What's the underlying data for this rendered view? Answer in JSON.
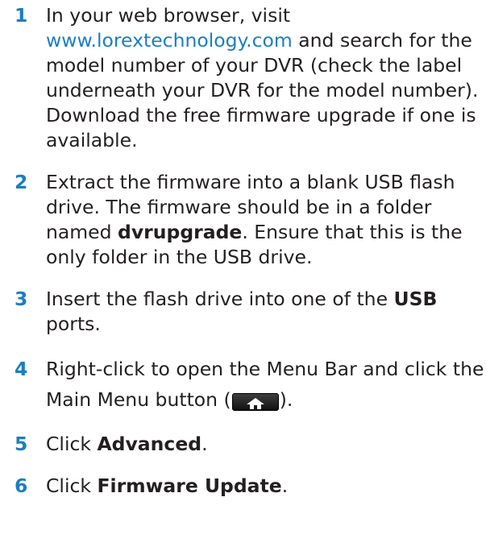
{
  "steps": [
    {
      "number": "1",
      "text_before": "In your web browser, visit",
      "link": "www.lorextechnology.com",
      "text_after": "and search for the model number of your DVR (check the label underneath your DVR for the model number). Download the free firmware upgrade if one is available."
    },
    {
      "number": "2",
      "text_before": "Extract the firmware into a blank USB flash drive. The firmware should be in a folder named",
      "bold": "dvrupgrade",
      "text_after": ". Ensure that this is the only folder in the USB drive."
    },
    {
      "number": "3",
      "text_before": "Insert the flash drive into one of the",
      "bold": "USB",
      "text_after": "ports."
    },
    {
      "number": "4",
      "text_before": "Right-click to open the Menu Bar and click the Main Menu button (",
      "icon": "home-icon",
      "text_after": ")."
    },
    {
      "number": "5",
      "text_before": "Click",
      "bold": "Advanced",
      "text_after": "."
    },
    {
      "number": "6",
      "text_before": "Click",
      "bold": "Firmware Update",
      "text_after": "."
    }
  ],
  "colors": {
    "step_number": "#1b7ec2",
    "link": "#1b7ec2",
    "text": "#231f20"
  }
}
